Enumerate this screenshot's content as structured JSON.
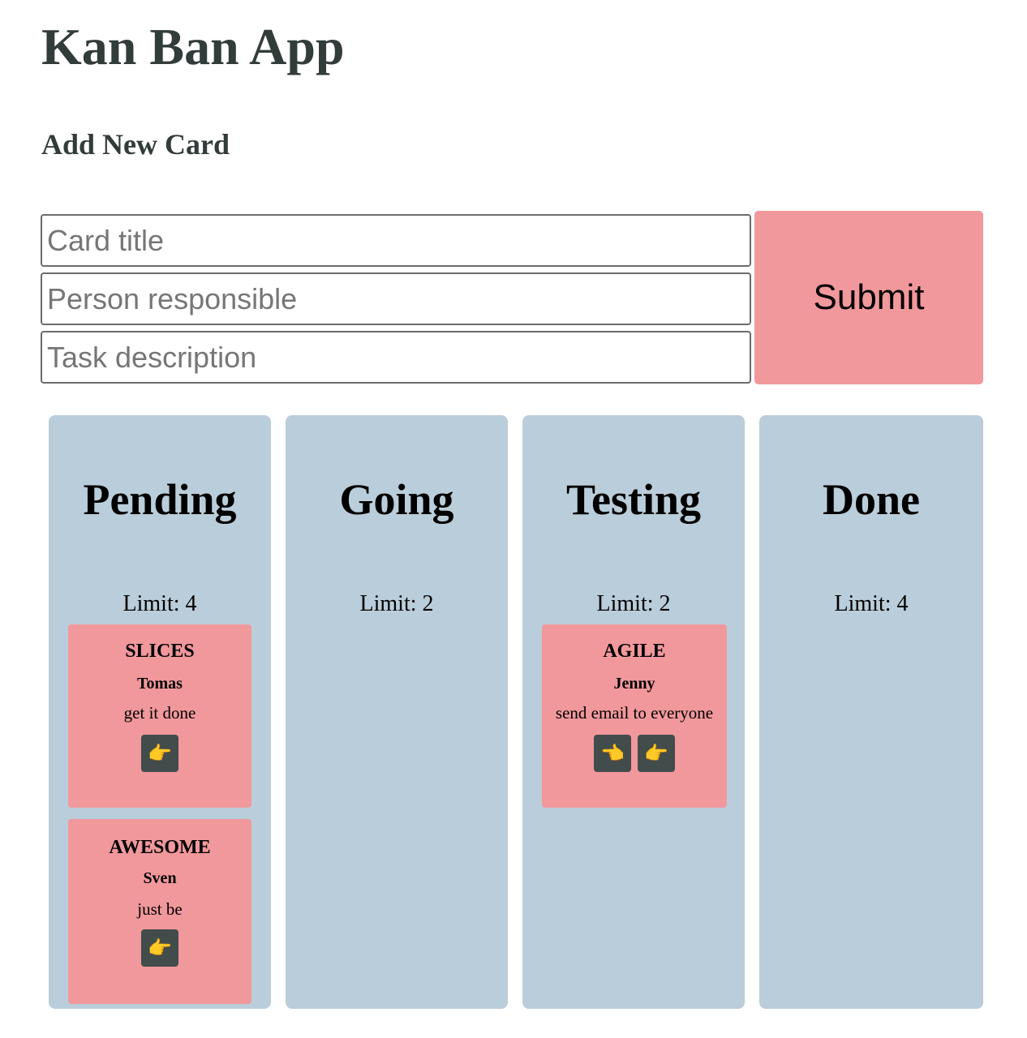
{
  "app": {
    "title": "Kan Ban App"
  },
  "form": {
    "heading": "Add New Card",
    "title_placeholder": "Card title",
    "title_value": "",
    "person_placeholder": "Person responsible",
    "person_value": "",
    "description_placeholder": "Task description",
    "description_value": "",
    "submit_label": "Submit"
  },
  "icons": {
    "move_right": "pointing-right-hand-icon",
    "move_left": "pointing-left-hand-icon",
    "right_glyph": "👉",
    "left_glyph": "👈"
  },
  "colors": {
    "column_bg": "#bacdda",
    "card_bg": "#f1989c",
    "button_bg": "#414c4b",
    "heading_text": "#323c3a"
  },
  "columns": [
    {
      "title": "Pending",
      "limit": "Limit: 4",
      "cards": [
        {
          "title": "SLICES",
          "person": "Tomas",
          "description": "get it done"
        },
        {
          "title": "AWESOME",
          "person": "Sven",
          "description": "just be"
        }
      ]
    },
    {
      "title": "Going",
      "limit": "Limit: 2",
      "cards": []
    },
    {
      "title": "Testing",
      "limit": "Limit: 2",
      "cards": [
        {
          "title": "AGILE",
          "person": "Jenny",
          "description": "send email to everyone"
        }
      ]
    },
    {
      "title": "Done",
      "limit": "Limit: 4",
      "cards": []
    }
  ]
}
